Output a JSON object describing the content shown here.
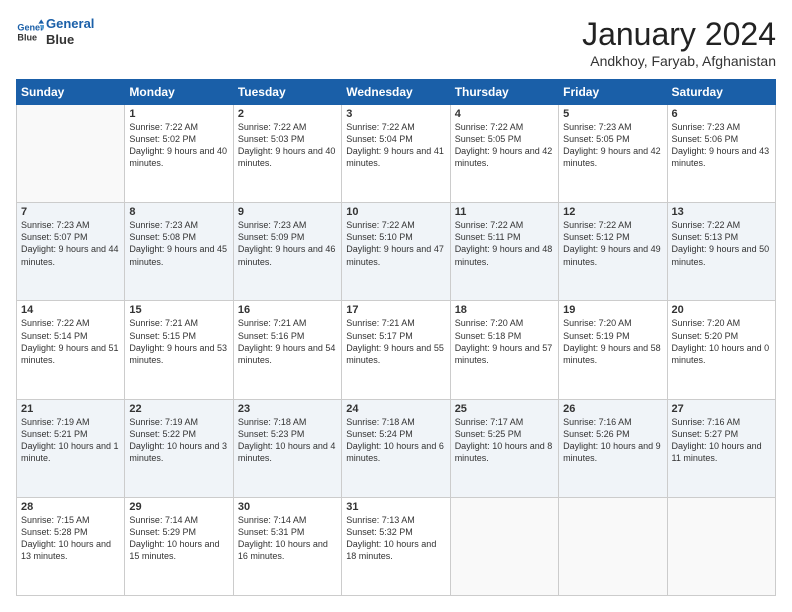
{
  "header": {
    "logo_line1": "General",
    "logo_line2": "Blue",
    "month_title": "January 2024",
    "location": "Andkhoy, Faryab, Afghanistan"
  },
  "weekdays": [
    "Sunday",
    "Monday",
    "Tuesday",
    "Wednesday",
    "Thursday",
    "Friday",
    "Saturday"
  ],
  "weeks": [
    [
      {
        "day": "",
        "sunrise": "",
        "sunset": "",
        "daylight": ""
      },
      {
        "day": "1",
        "sunrise": "Sunrise: 7:22 AM",
        "sunset": "Sunset: 5:02 PM",
        "daylight": "Daylight: 9 hours and 40 minutes."
      },
      {
        "day": "2",
        "sunrise": "Sunrise: 7:22 AM",
        "sunset": "Sunset: 5:03 PM",
        "daylight": "Daylight: 9 hours and 40 minutes."
      },
      {
        "day": "3",
        "sunrise": "Sunrise: 7:22 AM",
        "sunset": "Sunset: 5:04 PM",
        "daylight": "Daylight: 9 hours and 41 minutes."
      },
      {
        "day": "4",
        "sunrise": "Sunrise: 7:22 AM",
        "sunset": "Sunset: 5:05 PM",
        "daylight": "Daylight: 9 hours and 42 minutes."
      },
      {
        "day": "5",
        "sunrise": "Sunrise: 7:23 AM",
        "sunset": "Sunset: 5:05 PM",
        "daylight": "Daylight: 9 hours and 42 minutes."
      },
      {
        "day": "6",
        "sunrise": "Sunrise: 7:23 AM",
        "sunset": "Sunset: 5:06 PM",
        "daylight": "Daylight: 9 hours and 43 minutes."
      }
    ],
    [
      {
        "day": "7",
        "sunrise": "Sunrise: 7:23 AM",
        "sunset": "Sunset: 5:07 PM",
        "daylight": "Daylight: 9 hours and 44 minutes."
      },
      {
        "day": "8",
        "sunrise": "Sunrise: 7:23 AM",
        "sunset": "Sunset: 5:08 PM",
        "daylight": "Daylight: 9 hours and 45 minutes."
      },
      {
        "day": "9",
        "sunrise": "Sunrise: 7:23 AM",
        "sunset": "Sunset: 5:09 PM",
        "daylight": "Daylight: 9 hours and 46 minutes."
      },
      {
        "day": "10",
        "sunrise": "Sunrise: 7:22 AM",
        "sunset": "Sunset: 5:10 PM",
        "daylight": "Daylight: 9 hours and 47 minutes."
      },
      {
        "day": "11",
        "sunrise": "Sunrise: 7:22 AM",
        "sunset": "Sunset: 5:11 PM",
        "daylight": "Daylight: 9 hours and 48 minutes."
      },
      {
        "day": "12",
        "sunrise": "Sunrise: 7:22 AM",
        "sunset": "Sunset: 5:12 PM",
        "daylight": "Daylight: 9 hours and 49 minutes."
      },
      {
        "day": "13",
        "sunrise": "Sunrise: 7:22 AM",
        "sunset": "Sunset: 5:13 PM",
        "daylight": "Daylight: 9 hours and 50 minutes."
      }
    ],
    [
      {
        "day": "14",
        "sunrise": "Sunrise: 7:22 AM",
        "sunset": "Sunset: 5:14 PM",
        "daylight": "Daylight: 9 hours and 51 minutes."
      },
      {
        "day": "15",
        "sunrise": "Sunrise: 7:21 AM",
        "sunset": "Sunset: 5:15 PM",
        "daylight": "Daylight: 9 hours and 53 minutes."
      },
      {
        "day": "16",
        "sunrise": "Sunrise: 7:21 AM",
        "sunset": "Sunset: 5:16 PM",
        "daylight": "Daylight: 9 hours and 54 minutes."
      },
      {
        "day": "17",
        "sunrise": "Sunrise: 7:21 AM",
        "sunset": "Sunset: 5:17 PM",
        "daylight": "Daylight: 9 hours and 55 minutes."
      },
      {
        "day": "18",
        "sunrise": "Sunrise: 7:20 AM",
        "sunset": "Sunset: 5:18 PM",
        "daylight": "Daylight: 9 hours and 57 minutes."
      },
      {
        "day": "19",
        "sunrise": "Sunrise: 7:20 AM",
        "sunset": "Sunset: 5:19 PM",
        "daylight": "Daylight: 9 hours and 58 minutes."
      },
      {
        "day": "20",
        "sunrise": "Sunrise: 7:20 AM",
        "sunset": "Sunset: 5:20 PM",
        "daylight": "Daylight: 10 hours and 0 minutes."
      }
    ],
    [
      {
        "day": "21",
        "sunrise": "Sunrise: 7:19 AM",
        "sunset": "Sunset: 5:21 PM",
        "daylight": "Daylight: 10 hours and 1 minute."
      },
      {
        "day": "22",
        "sunrise": "Sunrise: 7:19 AM",
        "sunset": "Sunset: 5:22 PM",
        "daylight": "Daylight: 10 hours and 3 minutes."
      },
      {
        "day": "23",
        "sunrise": "Sunrise: 7:18 AM",
        "sunset": "Sunset: 5:23 PM",
        "daylight": "Daylight: 10 hours and 4 minutes."
      },
      {
        "day": "24",
        "sunrise": "Sunrise: 7:18 AM",
        "sunset": "Sunset: 5:24 PM",
        "daylight": "Daylight: 10 hours and 6 minutes."
      },
      {
        "day": "25",
        "sunrise": "Sunrise: 7:17 AM",
        "sunset": "Sunset: 5:25 PM",
        "daylight": "Daylight: 10 hours and 8 minutes."
      },
      {
        "day": "26",
        "sunrise": "Sunrise: 7:16 AM",
        "sunset": "Sunset: 5:26 PM",
        "daylight": "Daylight: 10 hours and 9 minutes."
      },
      {
        "day": "27",
        "sunrise": "Sunrise: 7:16 AM",
        "sunset": "Sunset: 5:27 PM",
        "daylight": "Daylight: 10 hours and 11 minutes."
      }
    ],
    [
      {
        "day": "28",
        "sunrise": "Sunrise: 7:15 AM",
        "sunset": "Sunset: 5:28 PM",
        "daylight": "Daylight: 10 hours and 13 minutes."
      },
      {
        "day": "29",
        "sunrise": "Sunrise: 7:14 AM",
        "sunset": "Sunset: 5:29 PM",
        "daylight": "Daylight: 10 hours and 15 minutes."
      },
      {
        "day": "30",
        "sunrise": "Sunrise: 7:14 AM",
        "sunset": "Sunset: 5:31 PM",
        "daylight": "Daylight: 10 hours and 16 minutes."
      },
      {
        "day": "31",
        "sunrise": "Sunrise: 7:13 AM",
        "sunset": "Sunset: 5:32 PM",
        "daylight": "Daylight: 10 hours and 18 minutes."
      },
      {
        "day": "",
        "sunrise": "",
        "sunset": "",
        "daylight": ""
      },
      {
        "day": "",
        "sunrise": "",
        "sunset": "",
        "daylight": ""
      },
      {
        "day": "",
        "sunrise": "",
        "sunset": "",
        "daylight": ""
      }
    ]
  ]
}
